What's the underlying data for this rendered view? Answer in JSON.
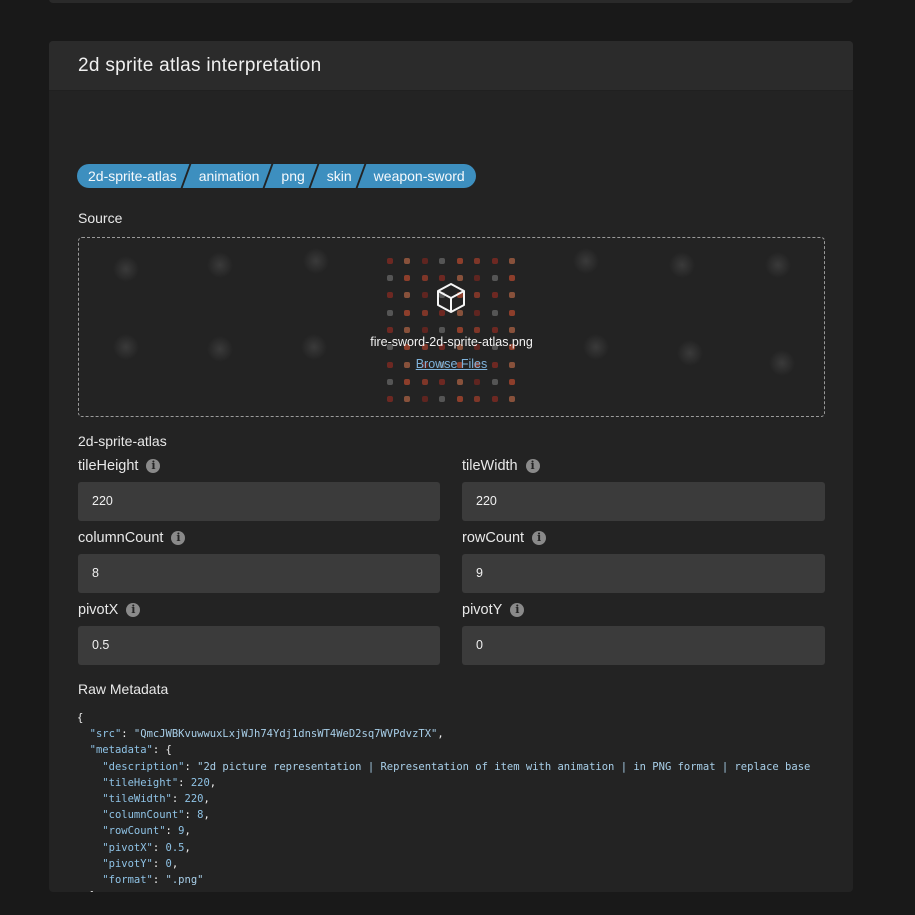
{
  "card": {
    "title": "2d sprite atlas interpretation"
  },
  "tags": [
    "2d-sprite-atlas",
    "animation",
    "png",
    "skin",
    "weapon-sword"
  ],
  "source": {
    "label": "Source",
    "filename": "fire-sword-2d-sprite-atlas.png",
    "browse_label": "Browse Files"
  },
  "section_title": "2d-sprite-atlas",
  "fields": {
    "tileHeight": {
      "label": "tileHeight",
      "value": "220"
    },
    "tileWidth": {
      "label": "tileWidth",
      "value": "220"
    },
    "columnCount": {
      "label": "columnCount",
      "value": "8"
    },
    "rowCount": {
      "label": "rowCount",
      "value": "9"
    },
    "pivotX": {
      "label": "pivotX",
      "value": "0.5"
    },
    "pivotY": {
      "label": "pivotY",
      "value": "0"
    }
  },
  "raw_metadata": {
    "label": "Raw Metadata",
    "src": "QmcJWBKvuwwuxLxjWJh74Ydj1dnsWT4WeD2sq7WVPdvzTX",
    "description": "2d picture representation | Representation of item with animation | in PNG format | replace base",
    "tileHeight": "220",
    "tileWidth": "220",
    "columnCount": "8",
    "rowCount": "9",
    "pivotX": "0.5",
    "pivotY": "0",
    "format": ".png"
  },
  "icons": {
    "drop": "cube-icon",
    "info": "info-icon"
  },
  "colors": {
    "tag_bg": "#3d8fbf",
    "input_bg": "#3b3b3b",
    "link": "#7fb3dc"
  }
}
